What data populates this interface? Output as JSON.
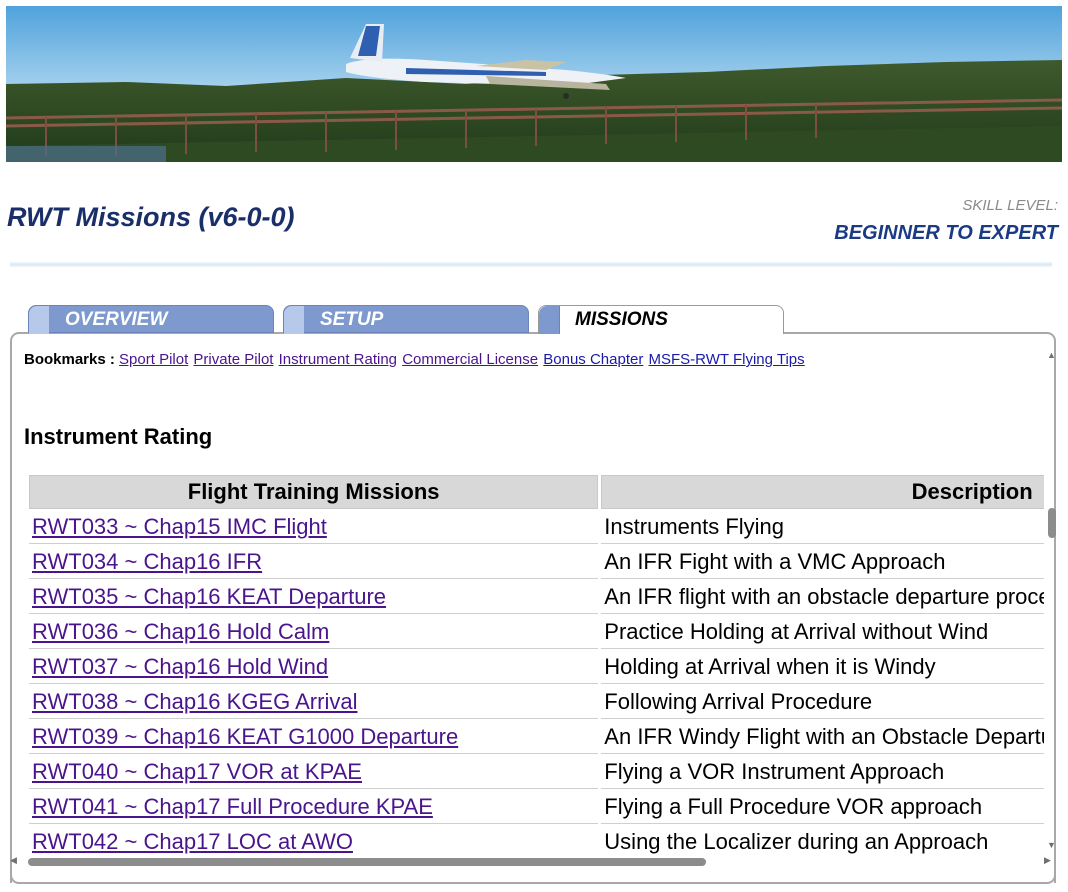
{
  "header": {
    "title": "RWT Missions (v6-0-0)",
    "skill_label": "SKILL LEVEL:",
    "skill_value": "BEGINNER TO EXPERT"
  },
  "tabs": [
    {
      "label": "OVERVIEW",
      "active": false
    },
    {
      "label": "SETUP",
      "active": false
    },
    {
      "label": "MISSIONS",
      "active": true
    }
  ],
  "bookmarks": {
    "label": "Bookmarks :",
    "links": [
      "Sport Pilot",
      "Private Pilot",
      "Instrument Rating",
      "Commercial License",
      "Bonus Chapter",
      "MSFS-RWT Flying Tips"
    ]
  },
  "section": {
    "heading": "Instrument Rating"
  },
  "table": {
    "headers": [
      "Flight Training Missions",
      "Description"
    ],
    "rows": [
      {
        "mission": "RWT033 ~ Chap15 IMC Flight",
        "description": "Instruments Flying"
      },
      {
        "mission": "RWT034 ~ Chap16 IFR",
        "description": "An IFR Fight with a VMC Approach"
      },
      {
        "mission": "RWT035 ~ Chap16 KEAT Departure",
        "description": "An IFR flight with an obstacle departure procedure"
      },
      {
        "mission": "RWT036 ~ Chap16 Hold Calm",
        "description": "Practice Holding at Arrival without Wind"
      },
      {
        "mission": "RWT037 ~ Chap16 Hold Wind",
        "description": "Holding at Arrival when it is Windy"
      },
      {
        "mission": "RWT038 ~ Chap16 KGEG Arrival",
        "description": "Following Arrival Procedure"
      },
      {
        "mission": "RWT039 ~ Chap16 KEAT G1000 Departure",
        "description": "An IFR Windy Flight with an Obstacle Departure"
      },
      {
        "mission": "RWT040 ~ Chap17 VOR at KPAE",
        "description": "Flying a VOR Instrument Approach"
      },
      {
        "mission": "RWT041 ~ Chap17 Full Procedure KPAE",
        "description": "Flying a Full Procedure VOR approach"
      },
      {
        "mission": "RWT042 ~ Chap17 LOC at AWO",
        "description": "Using the Localizer during an Approach"
      }
    ]
  },
  "icons": {
    "scroll_up": "▲",
    "scroll_down": "▼",
    "scroll_left": "◀",
    "scroll_right": "▶"
  },
  "colors": {
    "title": "#1a2f6a",
    "tab_inactive": "#7d99cd",
    "link_visited": "#4a148c"
  }
}
